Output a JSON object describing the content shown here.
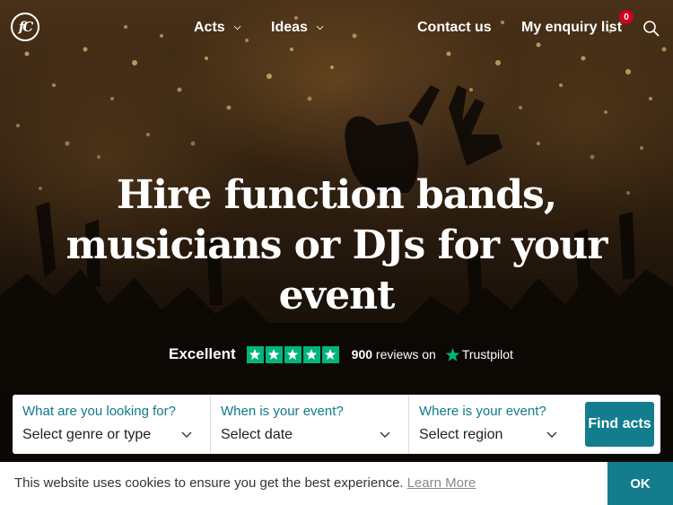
{
  "nav": {
    "logo_text": "fC",
    "acts_label": "Acts",
    "ideas_label": "Ideas",
    "contact_label": "Contact us",
    "enquiry_label": "My enquiry list",
    "enquiry_count": "0"
  },
  "hero": {
    "headline_line1": "Hire function bands,",
    "headline_line2": "musicians or DJs for your",
    "headline_line3": "event"
  },
  "trust": {
    "rating_text": "Excellent",
    "stars": 5,
    "review_count": "900",
    "reviews_suffix": "reviews on",
    "provider": "Trustpilot",
    "star_color": "#00b67a"
  },
  "search": {
    "genre_question": "What are you looking for?",
    "genre_placeholder": "Select genre or type",
    "date_question": "When is your event?",
    "date_placeholder": "Select date",
    "region_question": "Where is your event?",
    "region_placeholder": "Select region",
    "submit_label": "Find acts",
    "accent": "#137d8e"
  },
  "cookie": {
    "message": "This website uses cookies to ensure you get the best experience.",
    "learn_more": "Learn More",
    "ok_label": "OK"
  },
  "icons": [
    "logo-icon",
    "chevron-down-icon",
    "search-icon",
    "star-icon",
    "trustpilot-star-icon",
    "dropdown-arrow-icon"
  ]
}
